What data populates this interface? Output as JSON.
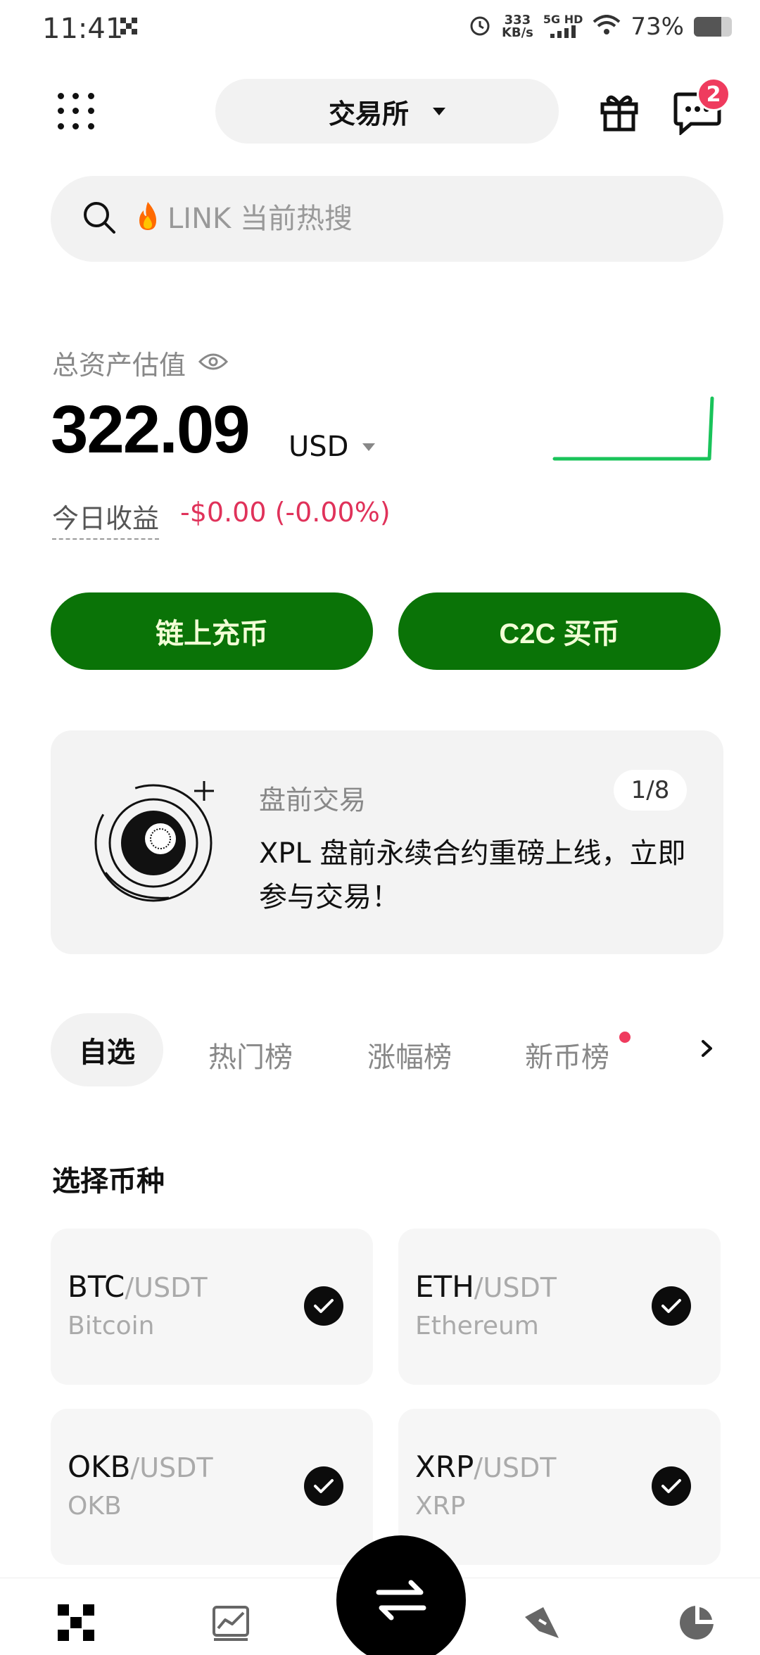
{
  "status_bar": {
    "time": "11:41",
    "notification_icon": "grid-x-icon",
    "speed_value": "333",
    "speed_unit": "KB/s",
    "network_top": "5G HD",
    "battery_percent": "73%",
    "battery_level": 0.73
  },
  "header": {
    "exchange_label": "交易所",
    "message_badge": "2"
  },
  "search": {
    "placeholder": "LINK 当前热搜"
  },
  "assets": {
    "label": "总资产估值",
    "value": "322.09",
    "currency": "USD",
    "pnl_label": "今日收益",
    "pnl_value": "-$0.00 (-0.00%)"
  },
  "actions": {
    "deposit_label": "链上充币",
    "buy_label": "C2C 买币"
  },
  "promo": {
    "tag": "盘前交易",
    "page_indicator": "1/8",
    "text": "XPL 盘前永续合约重磅上线，立即参与交易！"
  },
  "tabs": {
    "favorites": "自选",
    "hot": "热门榜",
    "gainers": "涨幅榜",
    "new_coins": "新币榜"
  },
  "select_coins": {
    "title": "选择币种",
    "items": [
      {
        "base": "BTC",
        "quote": "/USDT",
        "name": "Bitcoin"
      },
      {
        "base": "ETH",
        "quote": "/USDT",
        "name": "Ethereum"
      },
      {
        "base": "OKB",
        "quote": "/USDT",
        "name": "OKB"
      },
      {
        "base": "XRP",
        "quote": "/USDT",
        "name": "XRP"
      }
    ]
  },
  "colors": {
    "accent_green": "#0a7307",
    "negative_red": "#e0325a",
    "badge_red": "#ef3b5e",
    "sparkline_green": "#19c35a"
  },
  "icons": [
    "menu-grid-icon",
    "gift-icon",
    "message-icon",
    "search-icon",
    "fire-icon",
    "eye-icon",
    "chevron-right-icon",
    "check-icon",
    "home-icon",
    "markets-icon",
    "trade-swap-icon",
    "discover-icon",
    "assets-pie-icon"
  ]
}
